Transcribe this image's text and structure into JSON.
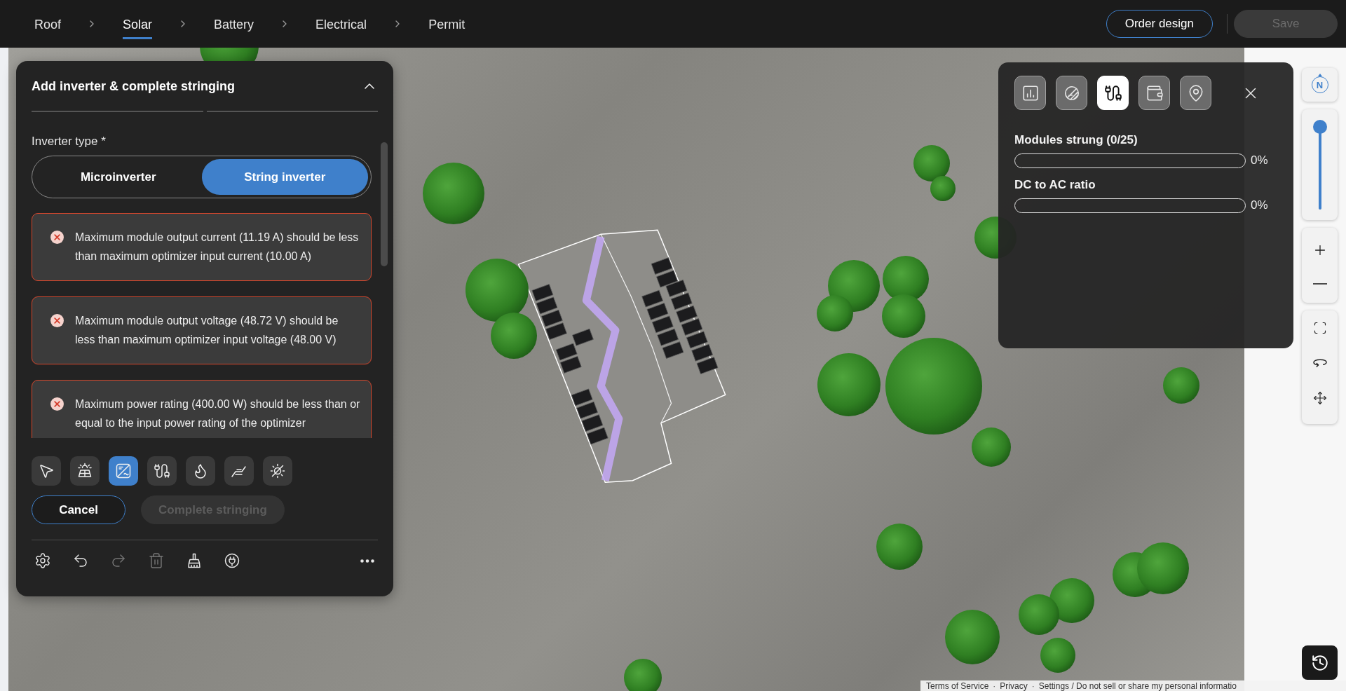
{
  "top_bar": {
    "steps": [
      {
        "label": "Roof",
        "selected": false
      },
      {
        "label": "Solar",
        "selected": true
      },
      {
        "label": "Battery",
        "selected": false
      },
      {
        "label": "Electrical",
        "selected": false
      },
      {
        "label": "Permit",
        "selected": false
      }
    ],
    "actions": [
      {
        "label": "Order design",
        "disabled": false
      },
      {
        "label": "Save",
        "disabled": true
      }
    ]
  },
  "stringing_panel": {
    "title": "Add inverter & complete stringing",
    "expanded": true,
    "inverter_type": {
      "label": "Inverter type *",
      "options": [
        {
          "label": "Microinverter",
          "selected": false
        },
        {
          "label": "String inverter",
          "selected": true
        }
      ]
    },
    "errors": [
      {
        "message": "Maximum module output current (11.19 A) should be less than maximum optimizer input current (10.00 A)"
      },
      {
        "message": "Maximum module output voltage (48.72 V) should be less than maximum optimizer input voltage (48.00 V)"
      },
      {
        "message": "Maximum power rating (400.00 W) should be less than or equal to the input power rating of the optimizer"
      }
    ],
    "tools": [
      {
        "kind": "select",
        "selected": false
      },
      {
        "kind": "solar_panel",
        "selected": false
      },
      {
        "kind": "inverter",
        "selected": true
      },
      {
        "kind": "cable",
        "selected": false
      },
      {
        "kind": "flame",
        "selected": false
      },
      {
        "kind": "ramp",
        "selected": false
      },
      {
        "kind": "shade",
        "selected": false
      }
    ],
    "buttons": [
      {
        "label": "Cancel",
        "disabled": false
      },
      {
        "label": "Complete stringing",
        "disabled": true
      }
    ],
    "bottom_tools": [
      {
        "kind": "settings",
        "disabled": false
      },
      {
        "kind": "undo",
        "disabled": false
      },
      {
        "kind": "redo",
        "disabled": true
      },
      {
        "kind": "delete",
        "disabled": true
      },
      {
        "kind": "clear",
        "disabled": false
      },
      {
        "kind": "plug",
        "disabled": false
      },
      {
        "kind": "more",
        "disabled": false
      }
    ]
  },
  "stats_panel": {
    "tabs": [
      {
        "kind": "chart",
        "selected": false
      },
      {
        "kind": "shade",
        "selected": false
      },
      {
        "kind": "cable",
        "selected": true
      },
      {
        "kind": "wallet",
        "selected": false
      },
      {
        "kind": "pin",
        "selected": false
      }
    ],
    "metrics": [
      {
        "label": "Modules strung (0/25)",
        "level": 0,
        "reading": "0%"
      },
      {
        "label": "DC to AC ratio",
        "level": 0,
        "reading": "0%"
      }
    ]
  },
  "map_controls": {
    "compass": {
      "label": "N"
    },
    "zoom": {
      "level": 1
    }
  },
  "footer": {
    "links": [
      "Terms of Service",
      "Privacy",
      "Settings / Do not sell or share my personal informatio"
    ],
    "separator": "·"
  }
}
